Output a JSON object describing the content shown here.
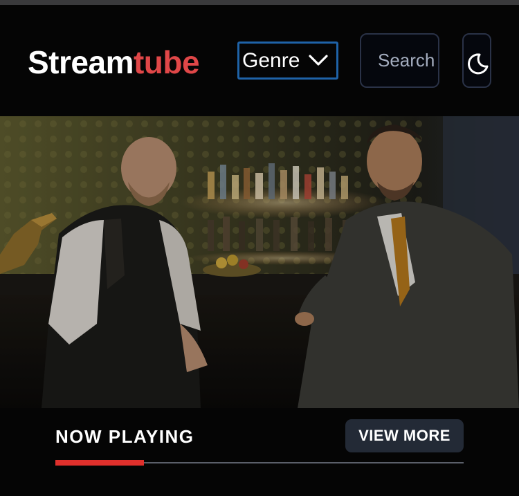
{
  "header": {
    "logo_part1": "Stream",
    "logo_part2": "tube",
    "genre_label": "Genre",
    "search_placeholder": "Search",
    "theme_icon": "moon-icon",
    "chevron_icon": "chevron-down-icon"
  },
  "section": {
    "title": "NOW PLAYING",
    "view_more_label": "VIEW MORE",
    "progress": 0.2169
  },
  "colors": {
    "brand_accent": "#e04748",
    "focus_border": "#1f63a8",
    "progress_fill": "#e0302c",
    "button_bg": "#232a36"
  }
}
